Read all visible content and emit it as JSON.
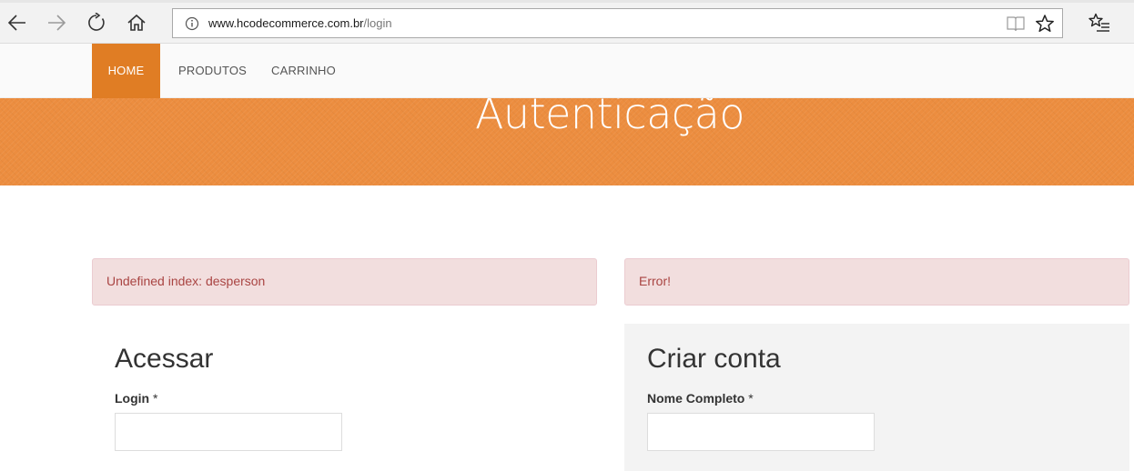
{
  "browser": {
    "url_host": "www.hcodecommerce.com.br",
    "url_path": "/login",
    "icons": [
      "back-arrow-icon",
      "forward-arrow-icon",
      "refresh-icon",
      "home-icon",
      "info-icon",
      "reading-view-icon",
      "star-icon",
      "favorites-list-icon"
    ]
  },
  "nav": {
    "items": [
      {
        "label": "HOME",
        "active": true
      },
      {
        "label": "PRODUTOS",
        "active": false
      },
      {
        "label": "CARRINHO",
        "active": false
      }
    ]
  },
  "banner": {
    "title": "Autenticação"
  },
  "alerts": {
    "login_error": "Undefined index: desperson",
    "register_error": "Error!"
  },
  "login": {
    "title": "Acessar",
    "label": "Login",
    "required_mark": " *",
    "value": ""
  },
  "register": {
    "title": "Criar conta",
    "label": "Nome Completo",
    "required_mark": " *",
    "value": ""
  },
  "colors": {
    "accent": "#e07d24",
    "banner": "#ec8d3f",
    "alert_bg": "#f2dede",
    "alert_text": "#a94442"
  }
}
